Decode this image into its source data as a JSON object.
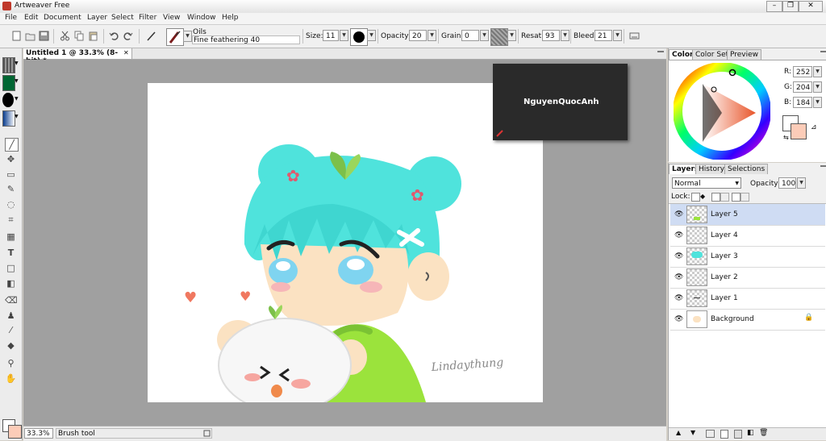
{
  "window": {
    "title": "Artweaver Free"
  },
  "menu": [
    "File",
    "Edit",
    "Document",
    "Layer",
    "Select",
    "Filter",
    "View",
    "Window",
    "Help"
  ],
  "toolbar": {
    "brush_category": "Oils",
    "brush_variant": "Fine feathering 40",
    "size_label": "Size:",
    "size_value": "11",
    "opacity_label": "Opacity:",
    "opacity_value": "20",
    "grain_label": "Grain:",
    "grain_value": "0",
    "resat_label": "Resat:",
    "resat_value": "93",
    "bleed_label": "Bleed:",
    "bleed_value": "21"
  },
  "document": {
    "tab_title": "Untitled 1 @ 33.3% (8-bit) *",
    "tab_close": "✕",
    "watermark": "NguyenQuocAnh",
    "signature": "Lindaythung"
  },
  "status": {
    "zoom": "33.3%",
    "tool": "Brush tool"
  },
  "color_panel": {
    "tabs": [
      "Color",
      "Color Set",
      "Preview"
    ],
    "r_label": "R:",
    "r_value": "252",
    "g_label": "G:",
    "g_value": "204",
    "b_label": "B:",
    "b_value": "184",
    "foreground": "#fcccb8",
    "background": "#ffffff"
  },
  "layers_panel": {
    "tabs": [
      "Layers",
      "History",
      "Selections"
    ],
    "blend_mode": "Normal",
    "opacity_label": "Opacity:",
    "opacity_value": "100",
    "lock_label": "Lock:",
    "layers": [
      {
        "name": "Layer 5",
        "selected": true
      },
      {
        "name": "Layer 4",
        "selected": false
      },
      {
        "name": "Layer 3",
        "selected": false
      },
      {
        "name": "Layer 2",
        "selected": false
      },
      {
        "name": "Layer 1",
        "selected": false
      },
      {
        "name": "Background",
        "selected": false,
        "locked": true
      }
    ]
  },
  "colors": {
    "accent_selection": "#cfdcf3",
    "hair": "#4fe3dc",
    "sweater": "#9be33c",
    "skin": "#fbe2c2"
  }
}
